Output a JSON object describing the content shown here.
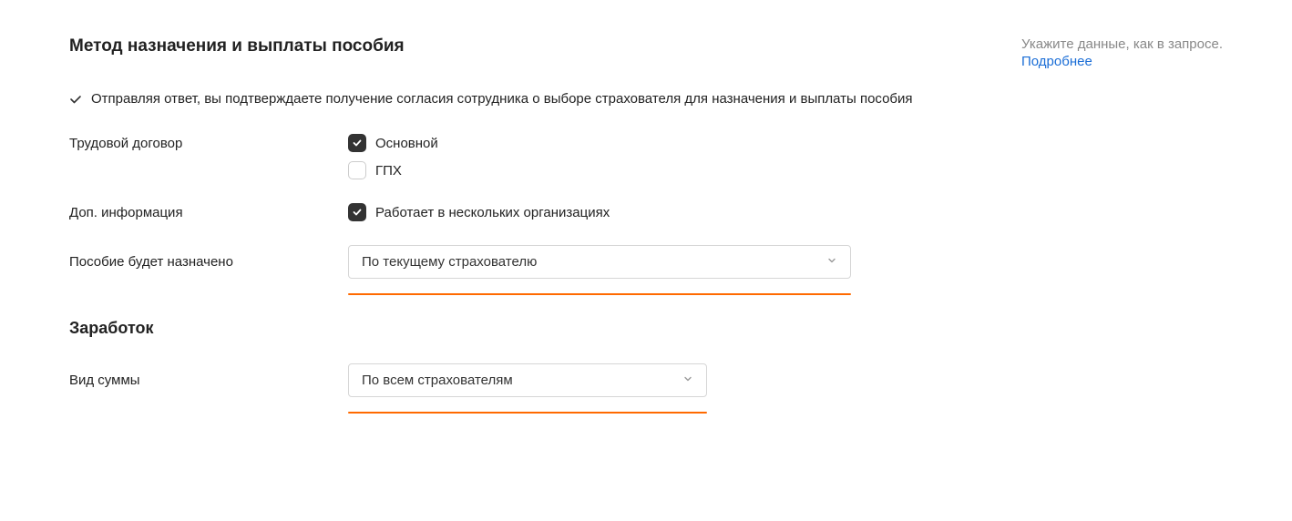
{
  "section_title": "Метод назначения и выплаты пособия",
  "hint": {
    "text": "Укажите данные, как в запросе.",
    "link": "Подробнее"
  },
  "consent_text": "Отправляя ответ, вы подтверждаете получение согласия сотрудника о выборе страхователя для назначения и выплаты пособия",
  "contract": {
    "label": "Трудовой договор",
    "options": [
      {
        "label": "Основной",
        "checked": true
      },
      {
        "label": "ГПХ",
        "checked": false
      }
    ]
  },
  "additional": {
    "label": "Доп. информация",
    "options": [
      {
        "label": "Работает в нескольких организациях",
        "checked": true
      }
    ]
  },
  "benefit": {
    "label": "Пособие будет назначено",
    "value": "По текущему страхователю"
  },
  "earnings_title": "Заработок",
  "sum_type": {
    "label": "Вид суммы",
    "value": "По всем страхователям"
  }
}
